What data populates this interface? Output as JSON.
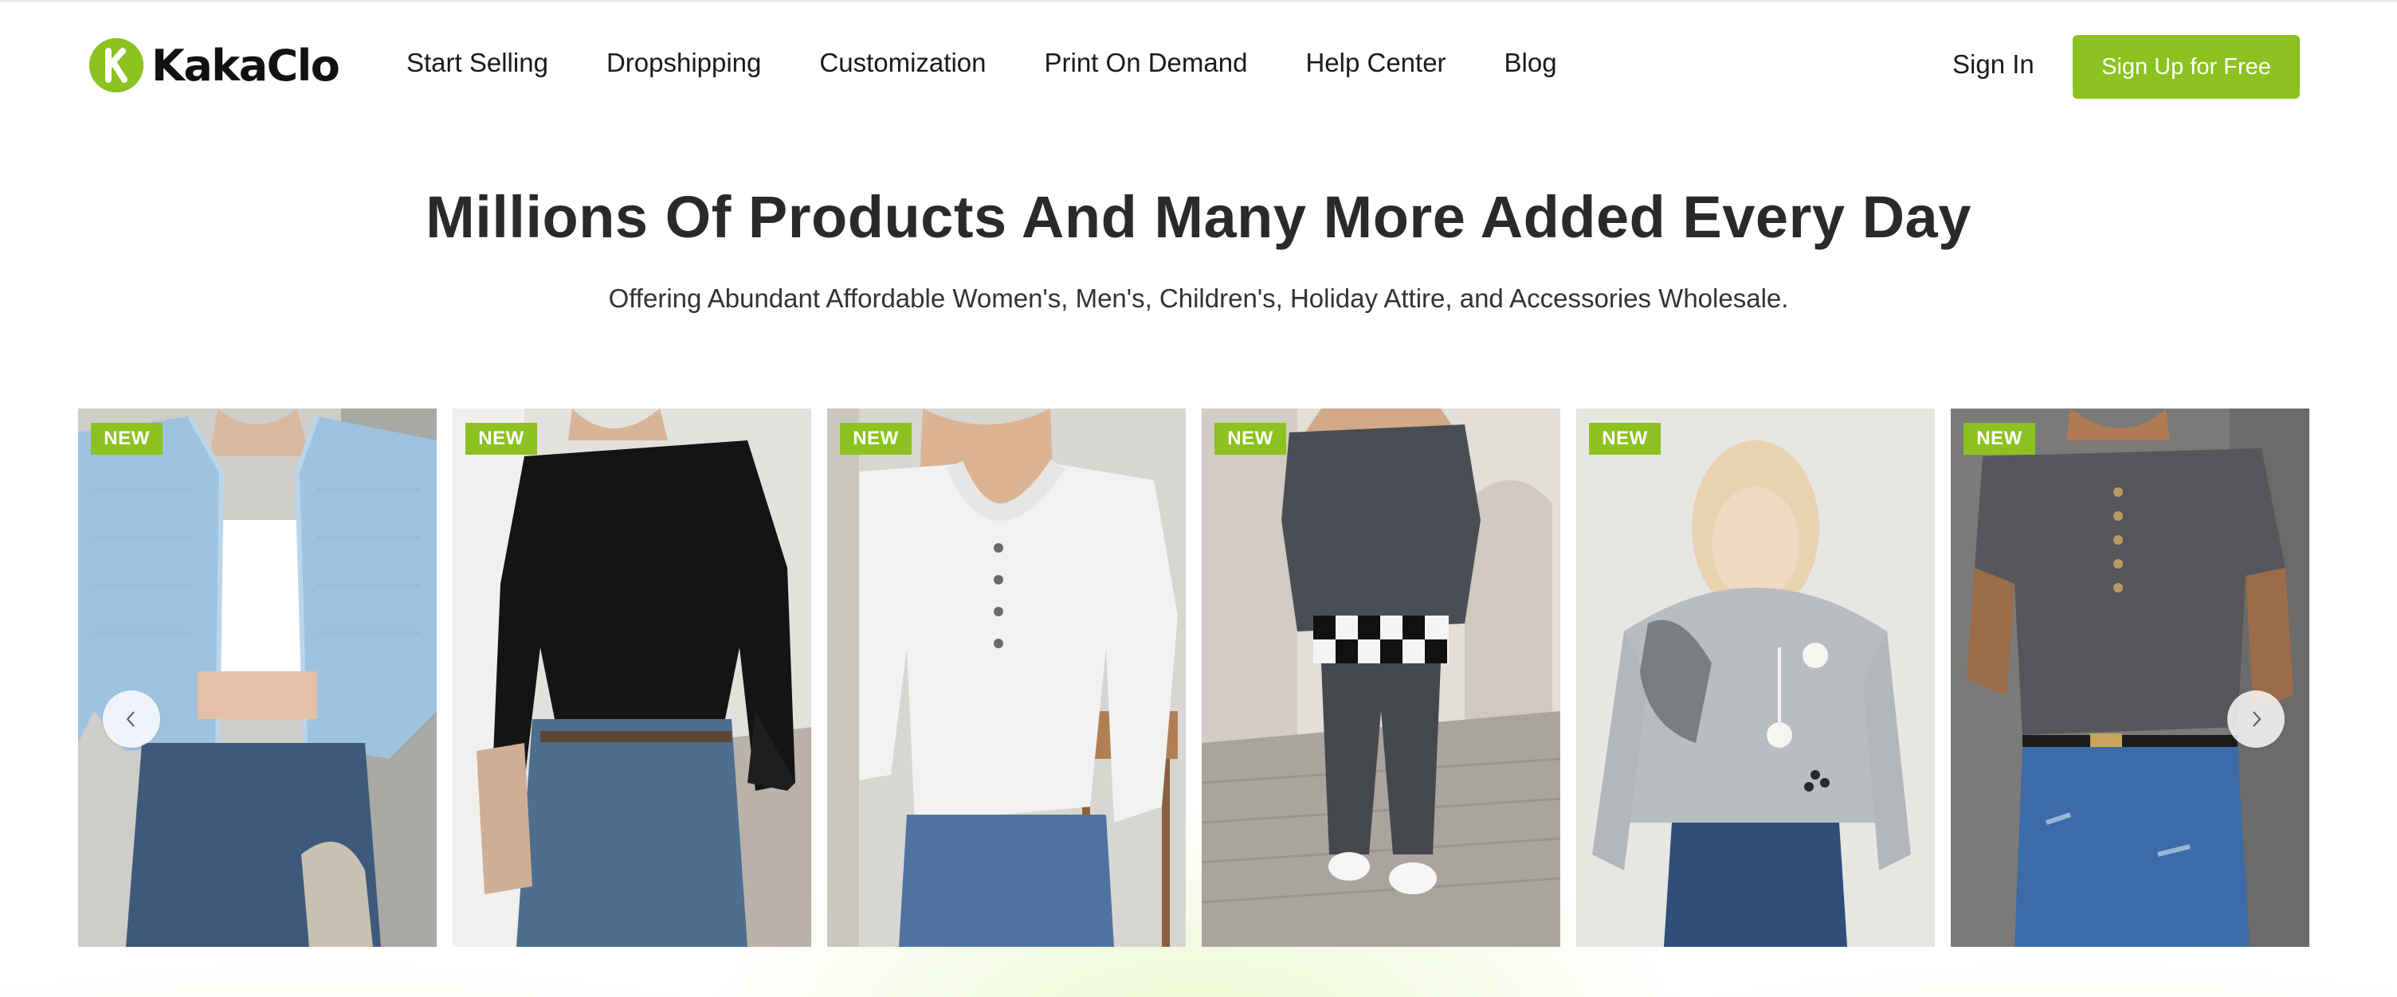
{
  "brand": {
    "name": "KakaClo",
    "logo_letter": "K",
    "accent_color": "#8cc220"
  },
  "nav": {
    "items": [
      {
        "label": "Start Selling"
      },
      {
        "label": "Dropshipping"
      },
      {
        "label": "Customization"
      },
      {
        "label": "Print On Demand"
      },
      {
        "label": "Help Center"
      },
      {
        "label": "Blog"
      }
    ],
    "sign_in": "Sign In",
    "sign_up": "Sign Up for Free"
  },
  "hero": {
    "title": "Millions Of Products And Many More Added Every Day",
    "subtitle": "Offering Abundant Affordable Women's, Men's, Children's, Holiday Attire, and Accessories Wholesale."
  },
  "carousel": {
    "prev_icon": "chevron-left-icon",
    "next_icon": "chevron-right-icon",
    "products": [
      {
        "badge": "NEW",
        "garment": "light blue waffle-knit cropped hoodie",
        "garment_color": "#9ec3e0"
      },
      {
        "badge": "NEW",
        "garment": "black long-sleeve ruffle top",
        "garment_color": "#141414"
      },
      {
        "badge": "NEW",
        "garment": "white lace henley top",
        "garment_color": "#f2f2f2"
      },
      {
        "badge": "NEW",
        "garment": "charcoal hoodie with plaid hem",
        "garment_color": "#4a4e54"
      },
      {
        "badge": "NEW",
        "garment": "heather grey cat print hoodie",
        "garment_color": "#b9bcc0"
      },
      {
        "badge": "NEW",
        "garment": "dark grey button henley tee",
        "garment_color": "#55575a"
      }
    ]
  }
}
